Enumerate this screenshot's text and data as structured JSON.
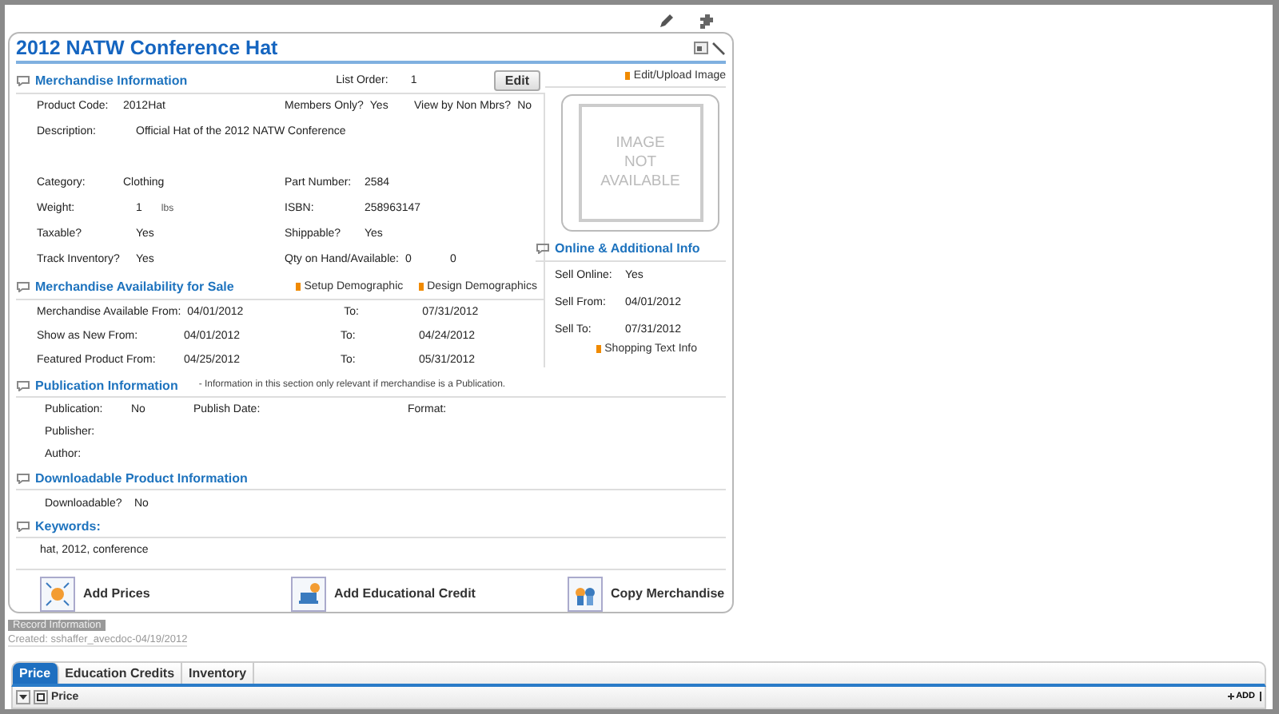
{
  "title": "2012 NATW Conference Hat",
  "list_order": {
    "label": "List Order:",
    "value": "1"
  },
  "edit_button": "Edit",
  "merchandise_info": {
    "heading": "Merchandise Information",
    "rows": [
      {
        "fields": [
          {
            "label": "Product Code:",
            "value": "2012Hat"
          },
          {
            "label": "Members Only?",
            "value": "Yes"
          },
          {
            "label": "View by Non Mbrs?",
            "value": "No"
          }
        ]
      },
      {
        "kind": "tall",
        "fields": [
          {
            "label": "Description:",
            "value": "Official Hat of the 2012 NATW Conference"
          }
        ]
      },
      {
        "fields": [
          {
            "label": "Category:",
            "value": "Clothing"
          },
          {
            "label": "Part Number:",
            "value": "2584"
          }
        ]
      },
      {
        "fields": [
          {
            "label": "Weight:",
            "value": "1",
            "unit": "lbs"
          },
          {
            "label": "ISBN:",
            "value": "258963147"
          }
        ]
      },
      {
        "fields": [
          {
            "label": "Taxable?",
            "value": "Yes"
          },
          {
            "label": "Shippable?",
            "value": "Yes"
          }
        ]
      },
      {
        "fields": [
          {
            "label": "Track Inventory?",
            "value": "Yes"
          },
          {
            "label": "Qty on Hand/Available:",
            "value": "0",
            "value_2": "0"
          }
        ]
      }
    ]
  },
  "availability": {
    "heading": "Merchandise Availability for Sale",
    "links": [
      "Setup Demographic",
      "Design Demographics"
    ],
    "rows": [
      {
        "label": "Merchandise Available From:",
        "from": "04/01/2012",
        "to_label": "To:",
        "to": "07/31/2012"
      },
      {
        "label": "Show as New From:",
        "from": "04/01/2012",
        "to_label": "To:",
        "to": "04/24/2012"
      },
      {
        "label": "Featured Product From:",
        "from": "04/25/2012",
        "to_label": "To:",
        "to": "05/31/2012"
      }
    ]
  },
  "image_panel": {
    "link": "Edit/Upload Image",
    "placeholder_lines": [
      "IMAGE",
      "NOT",
      "AVAILABLE"
    ]
  },
  "online_info": {
    "heading": "Online & Additional Info",
    "rows": [
      {
        "label": "Sell Online:",
        "value": "Yes"
      },
      {
        "label": "Sell From:",
        "value": "04/01/2012"
      },
      {
        "label": "Sell To:",
        "value": "07/31/2012"
      }
    ],
    "link": "Shopping Text Info"
  },
  "publication": {
    "heading": "Publication Information",
    "note": "- Information in this section only relevant if merchandise is a Publication.",
    "rows": [
      {
        "fields": [
          {
            "label": "Publication:",
            "value": "No"
          },
          {
            "label": "Publish Date:"
          },
          {
            "label": "Format:"
          }
        ]
      },
      {
        "fields": [
          {
            "label": "Publisher:"
          }
        ]
      },
      {
        "fields": [
          {
            "label": "Author:"
          }
        ]
      }
    ]
  },
  "downloadable": {
    "heading": "Downloadable Product Information",
    "label": "Downloadable?",
    "value": "No"
  },
  "keywords": {
    "heading": "Keywords:",
    "text": "hat, 2012, conference"
  },
  "actions": [
    {
      "kind": "prices",
      "label": "Add Prices"
    },
    {
      "kind": "credit",
      "label": "Add Educational Credit"
    },
    {
      "kind": "copy",
      "label": "Copy Merchandise"
    }
  ],
  "record_info": {
    "label": "Record Information",
    "created": "Created: sshaffer_avecdoc-04/19/2012"
  },
  "tabs": [
    {
      "label": "Price",
      "selected": true
    },
    {
      "label": "Education Credits",
      "selected": false
    },
    {
      "label": "Inventory",
      "selected": false
    }
  ],
  "panel": {
    "title": "Price",
    "add": "ADD"
  }
}
